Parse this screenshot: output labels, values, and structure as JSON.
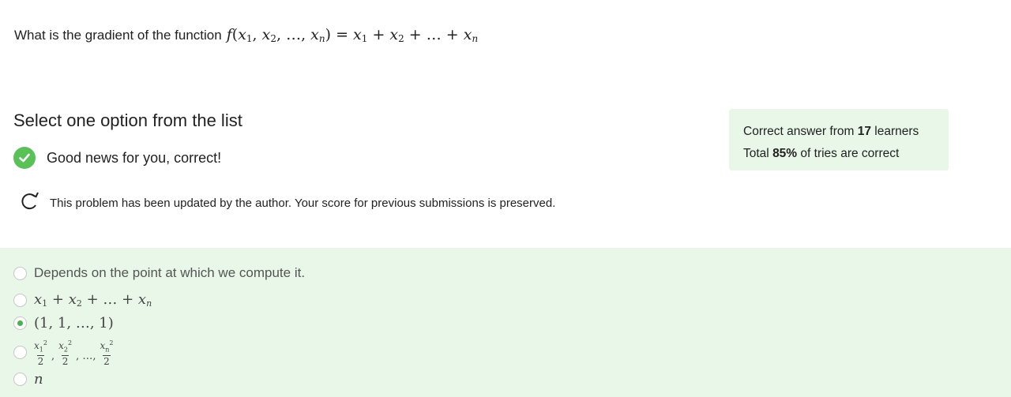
{
  "question": {
    "prefix": "What is the gradient of the function",
    "formula": {
      "fn": "f",
      "args": [
        "x1",
        "x2",
        "…",
        "xn"
      ],
      "rhs": [
        "x1",
        "+",
        "x2",
        "+",
        "…",
        "+",
        "xn"
      ]
    }
  },
  "select_title": "Select one option from the list",
  "status": {
    "text": "Good news for you, correct!",
    "icon": "check-icon",
    "color": "#59c157"
  },
  "notice": {
    "text": "This problem has been updated by the author. Your score for previous submissions is preserved.",
    "icon": "refresh-icon"
  },
  "stats": {
    "line1_prefix": "Correct answer from ",
    "learners": "17",
    "line1_suffix": " learners",
    "line2_prefix": "Total ",
    "percent": "85%",
    "line2_suffix": " of tries are correct"
  },
  "options": [
    {
      "text": "Depends on the point at which we compute it.",
      "selected": false
    },
    {
      "text": "x1 + x2 + … + xn",
      "selected": false
    },
    {
      "text": "(1, 1, …, 1)",
      "selected": true
    },
    {
      "text": "x1²/2, x2²/2, …, xn²/2",
      "selected": false
    },
    {
      "text": "n",
      "selected": false
    }
  ],
  "colors": {
    "accent": "#4caf50",
    "panel_bg": "#e8f7e7"
  }
}
